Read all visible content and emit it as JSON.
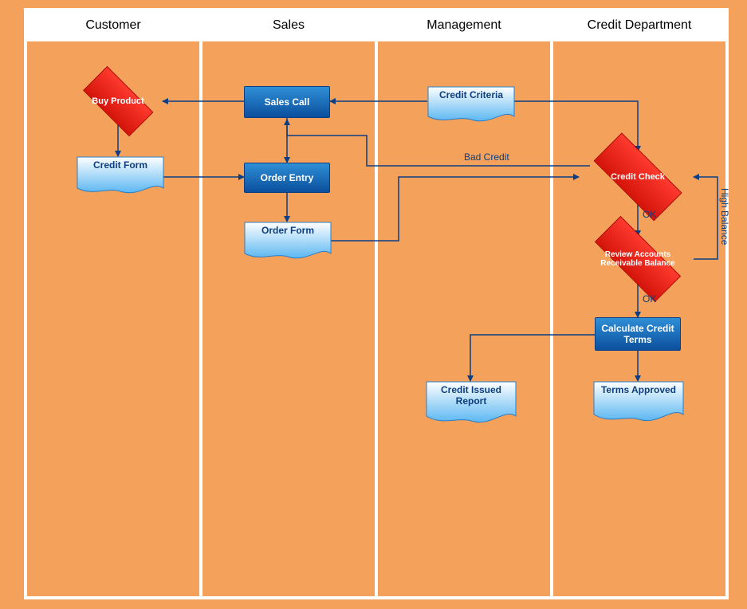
{
  "lanes": {
    "customer": "Customer",
    "sales": "Sales",
    "management": "Management",
    "credit": "Credit Department"
  },
  "nodes": {
    "buy_product": "Buy Product",
    "credit_form": "Credit Form",
    "sales_call": "Sales Call",
    "order_entry": "Order Entry",
    "order_form": "Order Form",
    "credit_criteria": "Credit Criteria",
    "credit_issued_report": "Credit Issued Report",
    "credit_check": "Credit Check",
    "review_accounts": "Review Accounts Receivable Balance",
    "calculate_terms": "Calculate Credit Terms",
    "terms_approved": "Terms Approved"
  },
  "edges": {
    "bad_credit": "Bad Credit",
    "ok1": "OK",
    "ok2": "OK",
    "high_balance": "High Balance"
  },
  "colors": {
    "lane_bg": "#f4a15b",
    "process_top": "#2f8fd6",
    "process_bottom": "#0b4f9e",
    "decision_top": "#ff3a2e",
    "decision_bottom": "#d4140b",
    "doc_top": "#ffffff",
    "doc_bottom": "#5bb7f2",
    "connector": "#0b3e82"
  }
}
